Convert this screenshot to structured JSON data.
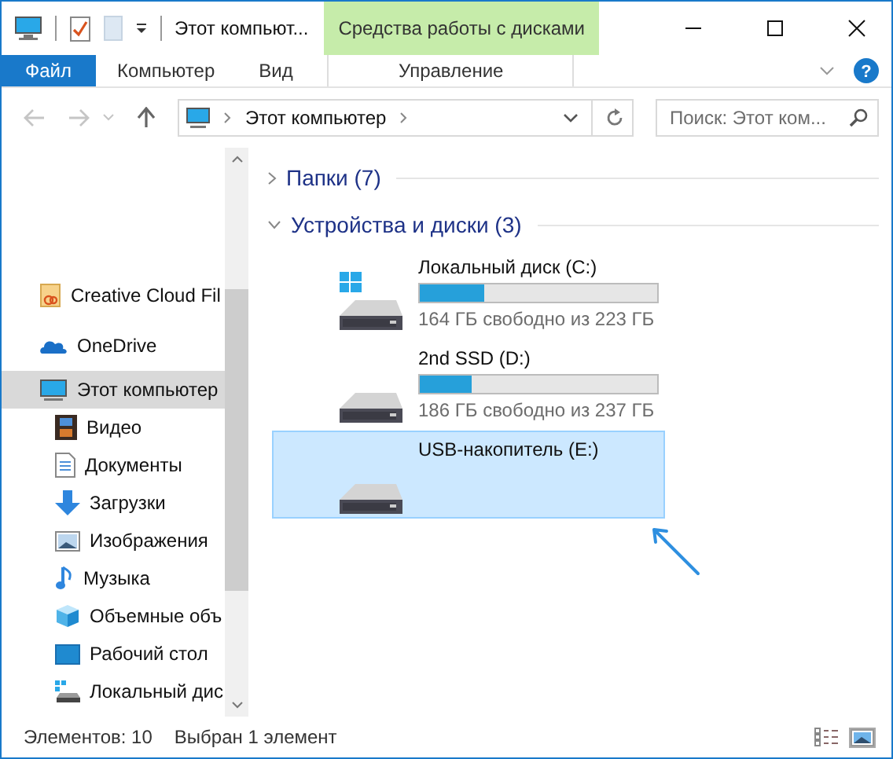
{
  "window": {
    "title": "Этот компьют...",
    "context_tab": "Средства работы с дисками",
    "help": "?"
  },
  "ribbon_tabs": [
    {
      "label": "Файл",
      "kind": "file"
    },
    {
      "label": "Компьютер",
      "kind": "tab"
    },
    {
      "label": "Вид",
      "kind": "tab"
    },
    {
      "label": "Управление",
      "kind": "context"
    }
  ],
  "address": {
    "path": "Этот компьютер",
    "search_placeholder": "Поиск: Этот ком..."
  },
  "sidebar": {
    "items": [
      {
        "label": "Creative Cloud Fil",
        "selected": false
      },
      {
        "label": "OneDrive",
        "selected": false
      },
      {
        "label": "Этот компьютер",
        "selected": true,
        "children": [
          {
            "label": "Видео",
            "selected": false
          },
          {
            "label": "Документы",
            "selected": false
          },
          {
            "label": "Загрузки",
            "selected": false
          },
          {
            "label": "Изображения",
            "selected": false
          },
          {
            "label": "Музыка",
            "selected": false
          },
          {
            "label": "Объемные объ",
            "selected": false
          },
          {
            "label": "Рабочий стол",
            "selected": false
          },
          {
            "label": "Локальный дис",
            "selected": false
          }
        ]
      }
    ]
  },
  "groups": [
    {
      "title": "Папки (7)",
      "expanded": false
    },
    {
      "title": "Устройства и диски (3)",
      "expanded": true
    }
  ],
  "drives": [
    {
      "name": "Локальный диск (C:)",
      "system": true,
      "level": 0.27,
      "free": "164 ГБ свободно из 223 ГБ",
      "selected": false
    },
    {
      "name": "2nd SSD (D:)",
      "system": false,
      "level": 0.22,
      "free": "186 ГБ свободно из 237 ГБ",
      "selected": false
    },
    {
      "name": "USB-накопитель (E:)",
      "system": false,
      "selected": true
    }
  ],
  "status_bar": {
    "count": "Элементов: 10",
    "selection": "Выбран 1 элемент"
  }
}
